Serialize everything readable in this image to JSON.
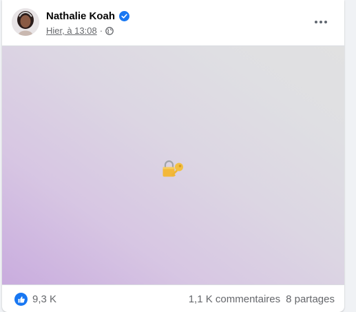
{
  "post": {
    "author": "Nathalie Koah",
    "timestamp": "Hier, à 13:08",
    "separator": "·",
    "visibility_icon": "globe-icon",
    "verified_icon": "verified-badge-icon",
    "more_icon": "more-options-icon"
  },
  "media": {
    "emoji": "🔐",
    "emoji_icon": "locked-with-key-icon"
  },
  "footer": {
    "reaction_icon": "like-reaction-icon",
    "reaction_count": "9,3 K",
    "comments": "1,1 K commentaires",
    "shares": "8 partages"
  },
  "colors": {
    "accent": "#1877f2",
    "secondary_text": "#65676b",
    "gradient_start": "#c9acde",
    "gradient_end": "#e1e1e1"
  }
}
